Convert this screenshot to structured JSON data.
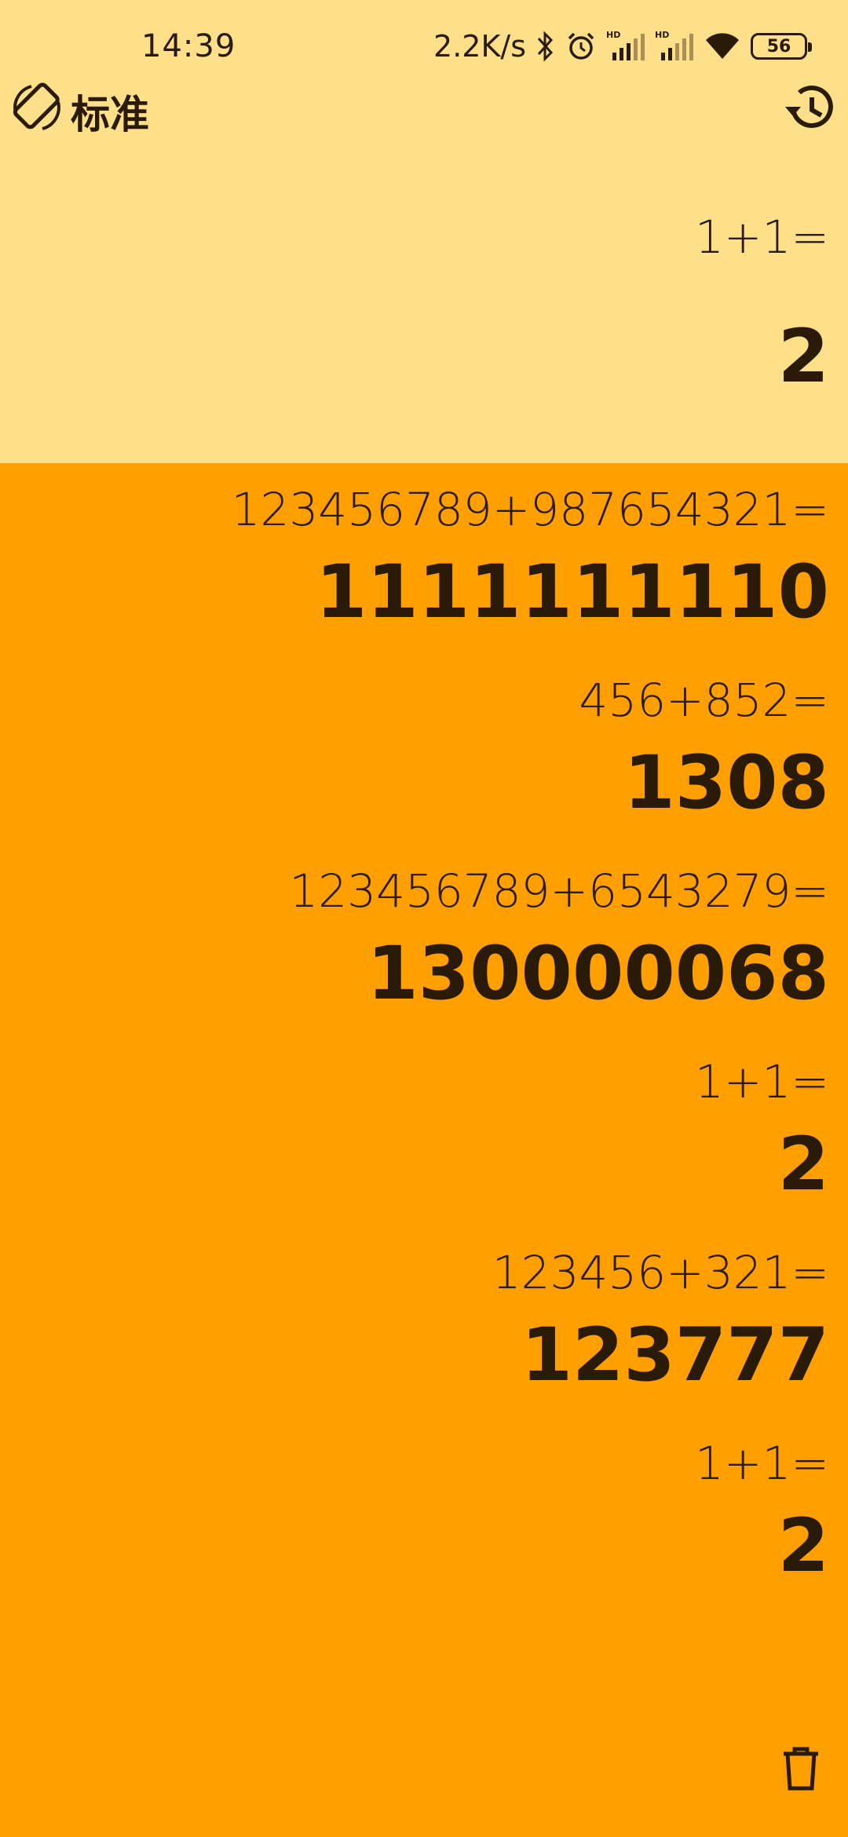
{
  "status_bar": {
    "time": "14:39",
    "net_speed": "2.2K/s",
    "battery_level": "56",
    "icons": [
      "bluetooth-icon",
      "alarm-icon",
      "signal-hd-icon",
      "signal-hd-icon",
      "wifi-icon",
      "battery-icon"
    ]
  },
  "header": {
    "mode_label": "标准",
    "left_icon": "screen-rotation-icon",
    "right_icon": "history-icon"
  },
  "current": {
    "expression": "1+1=",
    "result": "2"
  },
  "history": [
    {
      "expression": "123456789+987654321=",
      "result": "1111111110"
    },
    {
      "expression": "456+852=",
      "result": "1308"
    },
    {
      "expression": "123456789+6543279=",
      "result": "130000068"
    },
    {
      "expression": "1+1=",
      "result": "2"
    },
    {
      "expression": "123456+321=",
      "result": "123777"
    },
    {
      "expression": "1+1=",
      "result": "2"
    }
  ],
  "footer": {
    "delete_icon": "trash-icon"
  },
  "colors": {
    "top_panel": "#FFE08A",
    "history_panel": "#FFA000",
    "text": "#2a1a08"
  }
}
